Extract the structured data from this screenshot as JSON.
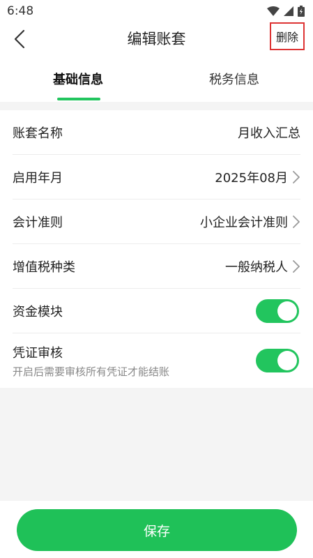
{
  "status_bar": {
    "time": "6:48",
    "icons": [
      "wifi-icon",
      "signal-icon",
      "battery-icon"
    ]
  },
  "nav": {
    "title": "编辑账套",
    "back_icon": "chevron-left-icon",
    "delete_label": "删除"
  },
  "tabs": [
    {
      "label": "基础信息",
      "active": true
    },
    {
      "label": "税务信息",
      "active": false
    }
  ],
  "form": {
    "rows": [
      {
        "label": "账套名称",
        "value": "月收入汇总"
      },
      {
        "label": "启用年月",
        "value": "2025年08月"
      },
      {
        "label": "会计准则",
        "value": "小企业会计准则"
      },
      {
        "label": "增值税种类",
        "value": "一般纳税人"
      }
    ],
    "fund_module": {
      "label": "资金模块",
      "enabled": true
    },
    "voucher_review": {
      "label": "凭证审核",
      "description": "开启后需要审核所有凭证才能结账",
      "enabled": true
    }
  },
  "save_label": "保存",
  "colors": {
    "accent": "#22c55e",
    "button": "#1fc158",
    "highlight_border": "#d33333"
  }
}
